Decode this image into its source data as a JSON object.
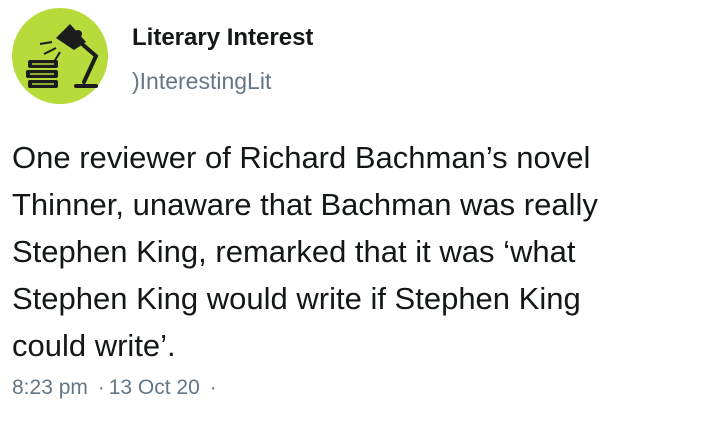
{
  "account": {
    "display_name": "Literary Interest",
    "handle": ")InterestingLit",
    "avatar_icon": "desk-lamp-books-icon",
    "avatar_color": "#b6db3a"
  },
  "tweet": {
    "text": "One reviewer of Richard Bachman’s novel\nThinner, unaware that Bachman was really\nStephen King, remarked that it was ‘what\nStephen King would write if Stephen King\ncould write’."
  },
  "meta": {
    "time": "8:23 pm",
    "separator": "·",
    "date": "13 Oct 20",
    "trailing": "·"
  }
}
